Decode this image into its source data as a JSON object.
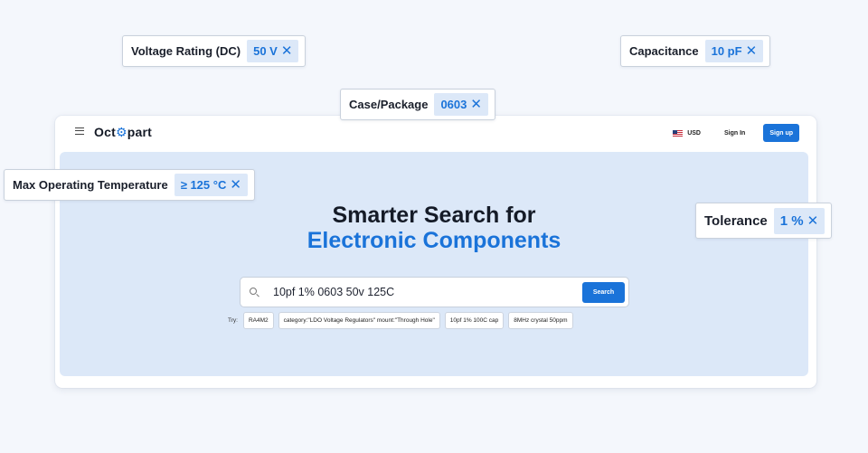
{
  "nav": {
    "logo": {
      "prefix": "Oct",
      "gear": "⚙",
      "suffix": "part"
    },
    "currency": "USD",
    "sign_in": "Sign In",
    "sign_up": "Sign up"
  },
  "hero": {
    "headline_line1": "Smarter Search for",
    "headline_line2": "Electronic Components"
  },
  "search": {
    "query": "10pf 1% 0603 50v 125C",
    "button": "Search"
  },
  "try": {
    "label": "Try:",
    "chips": [
      "RA4M2",
      "category:\"LDO Voltage Regulators\" mount:\"Through Hole\"",
      "10pf 1% 100C cap",
      "8MHz crystal 50ppm"
    ]
  },
  "filters": [
    {
      "name": "Voltage Rating (DC)",
      "value": "50 V"
    },
    {
      "name": "Capacitance",
      "value": "10 pF"
    },
    {
      "name": "Case/Package",
      "value": "0603"
    },
    {
      "name": "Max Operating Temperature",
      "value": "≥ 125 °C"
    },
    {
      "name": "Tolerance",
      "value": "1 %"
    }
  ],
  "colors": {
    "accent": "#1a73d9",
    "hero_bg": "#dce8f8",
    "page_bg": "#f4f7fc"
  },
  "icons": {
    "menu": "hamburger-icon",
    "search": "search-icon",
    "remove": "close-icon",
    "flag": "us-flag-icon"
  }
}
